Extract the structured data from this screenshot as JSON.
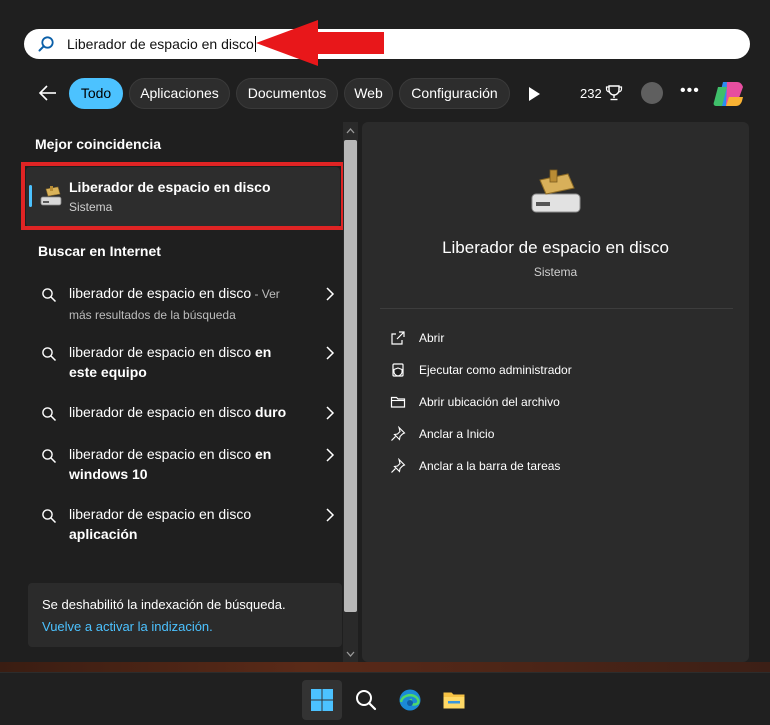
{
  "search": {
    "query": "Liberador de espacio en disco"
  },
  "filters": {
    "tabs": [
      {
        "label": "Todo"
      },
      {
        "label": "Aplicaciones"
      },
      {
        "label": "Documentos"
      },
      {
        "label": "Web"
      },
      {
        "label": "Configuración"
      }
    ],
    "active": "Todo",
    "points": "232"
  },
  "left": {
    "best_match_heading": "Mejor coincidencia",
    "best_match": {
      "title": "Liberador de espacio en disco",
      "subtitle": "Sistema"
    },
    "web_heading": "Buscar en Internet",
    "web_results": [
      {
        "main": "liberador de espacio en disco",
        "suffix": " - Ver",
        "line2": "más resultados de la búsqueda"
      },
      {
        "main": "liberador de espacio en disco ",
        "bold": "en",
        "line2": "este equipo"
      },
      {
        "main": "liberador de espacio en disco ",
        "bold": "duro"
      },
      {
        "main": "liberador de espacio en disco ",
        "bold": "en",
        "line2": "windows 10"
      },
      {
        "main": "liberador de espacio en disco",
        "line2": "aplicación"
      }
    ],
    "notice": {
      "text": "Se deshabilitó la indexación de búsqueda.",
      "link": "Vuelve a activar la indización."
    }
  },
  "right": {
    "title": "Liberador de espacio en disco",
    "subtitle": "Sistema",
    "actions": [
      {
        "label": "Abrir",
        "icon": "open-icon"
      },
      {
        "label": "Ejecutar como administrador",
        "icon": "shield-icon"
      },
      {
        "label": "Abrir ubicación del archivo",
        "icon": "folder-icon"
      },
      {
        "label": "Anclar a Inicio",
        "icon": "pin-icon"
      },
      {
        "label": "Anclar a la barra de tareas",
        "icon": "pin-icon"
      }
    ]
  },
  "taskbar": [
    "windows-start-icon",
    "search-icon",
    "edge-icon",
    "file-explorer-icon"
  ],
  "colors": {
    "accent": "#4cc2ff",
    "highlight_box": "#e02424",
    "background": "#1f1f1f"
  }
}
